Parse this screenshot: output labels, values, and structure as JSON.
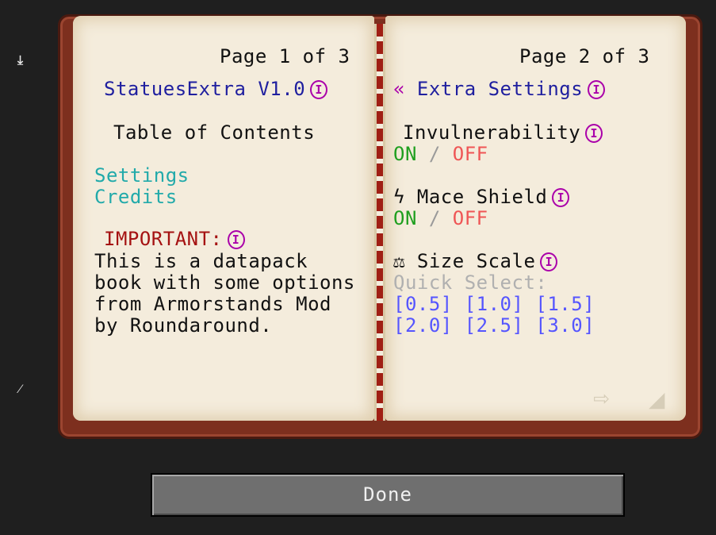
{
  "left_page": {
    "page_number": "Page 1 of 3",
    "title": "StatuesExtra V1.0",
    "info_badge": "I",
    "toc_heading": "Table of Contents",
    "toc_items": [
      "Settings",
      "Credits"
    ],
    "important_label": "IMPORTANT:",
    "important_lines": [
      "This is a datapack",
      "book with some options",
      "from Armorstands Mod",
      "by Roundaround."
    ]
  },
  "right_page": {
    "page_number": "Page 2 of 3",
    "back_arrow": "«",
    "title": "Extra Settings",
    "settings": [
      {
        "icon": "",
        "label": "Invulnerability",
        "on": "ON",
        "sep": "/",
        "off": "OFF"
      },
      {
        "icon": "ϟ",
        "label": "Mace Shield",
        "on": "ON",
        "sep": "/",
        "off": "OFF"
      }
    ],
    "size_scale": {
      "icon": "⚖",
      "label": "Size Scale",
      "quick_select": "Quick Select:",
      "row1": [
        "[0.5]",
        "[1.0]",
        "[1.5]"
      ],
      "row2": [
        "[2.0]",
        "[2.5]",
        "[3.0]"
      ]
    }
  },
  "done_button": "Done",
  "colors": {
    "page": "#f4ecdc",
    "cover": "#7d2f1e",
    "link_blue": "#5555ff",
    "info_purple": "#aa00aa"
  }
}
